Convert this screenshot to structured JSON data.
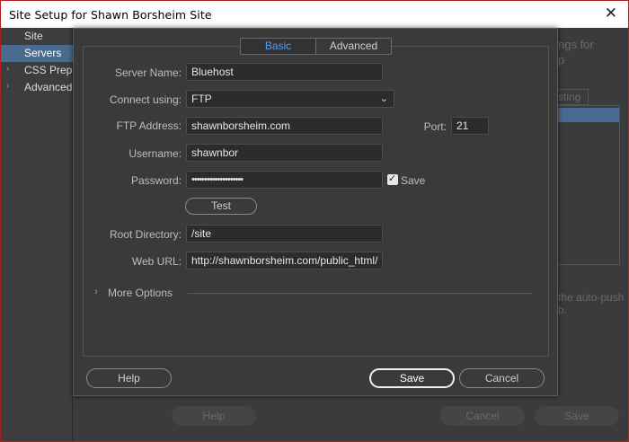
{
  "window": {
    "title": "Site Setup for Shawn Borsheim Site",
    "close_glyph": "✕"
  },
  "sidebar": {
    "items": [
      {
        "label": "Site",
        "arrow": ""
      },
      {
        "label": "Servers",
        "arrow": ""
      },
      {
        "label": "CSS Preprocessors",
        "arrow": "›"
      },
      {
        "label": "Advanced Settings",
        "arrow": "›"
      }
    ],
    "selected_color": "#4a6b90"
  },
  "background": {
    "heading_fragment": "ngs for",
    "heading_fragment2": "p",
    "tab_fragment": "sting",
    "autopush_fragment": "the auto-push",
    "autopush_fragment2": "b.",
    "help_label": "Help",
    "cancel_label": "Cancel",
    "save_label": "Save"
  },
  "dialog": {
    "tabs": [
      {
        "label": "Basic",
        "active": true
      },
      {
        "label": "Advanced",
        "active": false
      }
    ],
    "active_tab_color": "#4ea0f0",
    "fields": {
      "server_name": {
        "label": "Server Name:",
        "value": "Bluehost"
      },
      "connect_using": {
        "label": "Connect using:",
        "value": "FTP"
      },
      "ftp_address": {
        "label": "FTP Address:",
        "value": "shawnborsheim.com"
      },
      "port": {
        "label": "Port:",
        "value": "21"
      },
      "username": {
        "label": "Username:",
        "value": "shawnbor"
      },
      "password": {
        "label": "Password:",
        "value": "••••••••••••••••••••",
        "save_label": "Save",
        "save_checked": true
      },
      "root_directory": {
        "label": "Root Directory:",
        "value": "/site"
      },
      "web_url": {
        "label": "Web URL:",
        "value": "http://shawnborsheim.com/public_html/"
      }
    },
    "test_label": "Test",
    "more_options_label": "More Options",
    "more_options_icon": "chevron-right-icon",
    "help_label": "Help",
    "save_label": "Save",
    "cancel_label": "Cancel"
  }
}
